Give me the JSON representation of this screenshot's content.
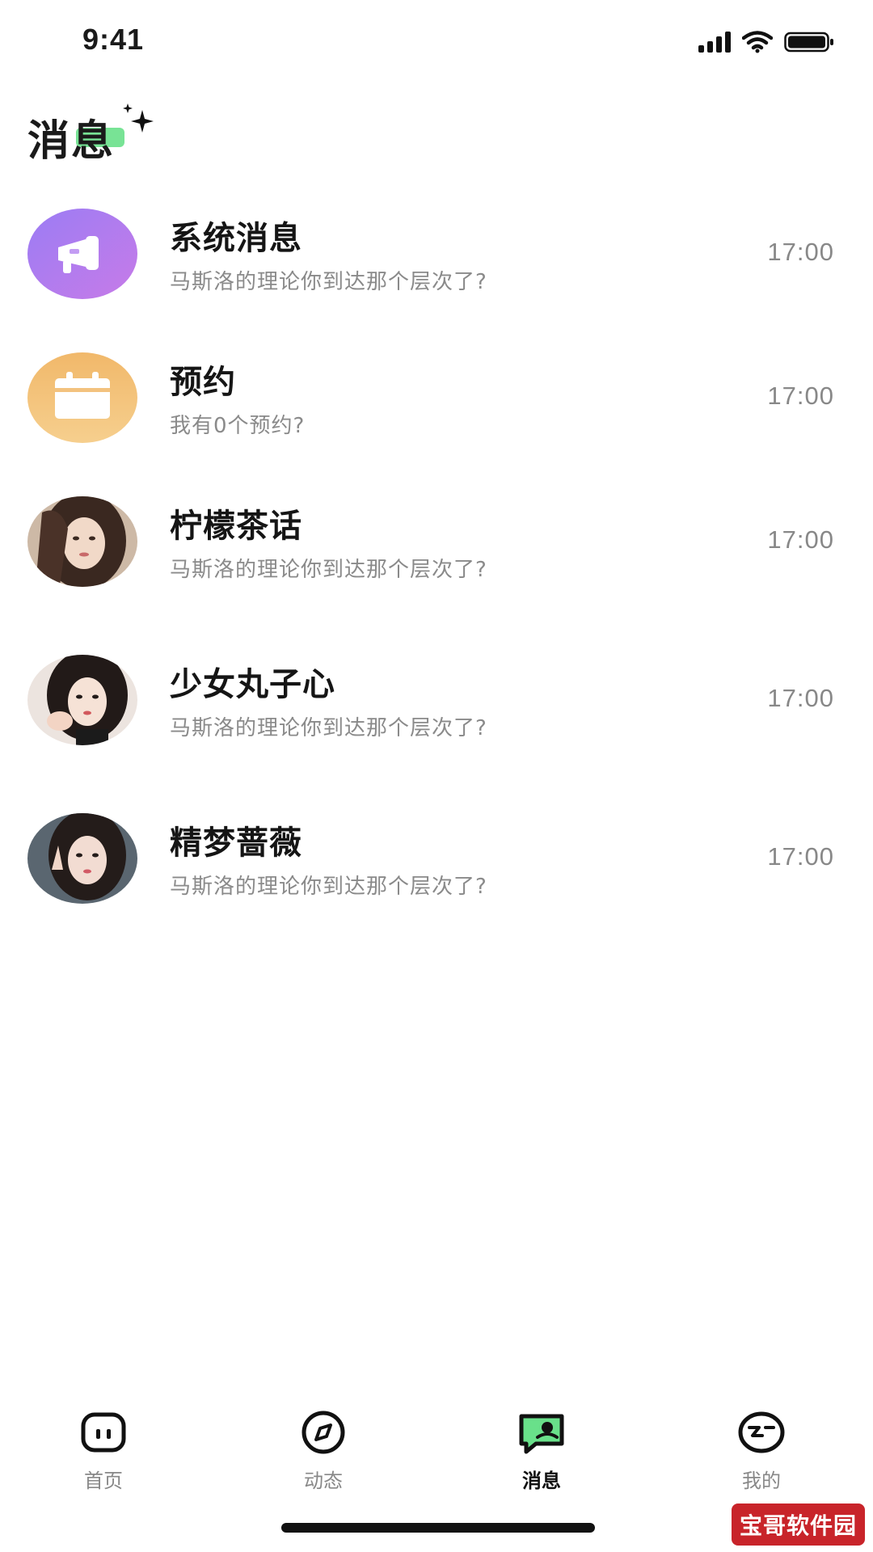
{
  "status_bar": {
    "time": "9:41"
  },
  "header": {
    "title": "消息"
  },
  "messages": [
    {
      "name": "系统消息",
      "preview": "马斯洛的理论你到达那个层次了?",
      "time": "17:00",
      "avatar": "megaphone-icon"
    },
    {
      "name": "预约",
      "preview": "我有0个预约?",
      "time": "17:00",
      "avatar": "calendar-icon"
    },
    {
      "name": "柠檬茶话",
      "preview": "马斯洛的理论你到达那个层次了?",
      "time": "17:00",
      "avatar": "user-photo"
    },
    {
      "name": "少女丸子心",
      "preview": "马斯洛的理论你到达那个层次了?",
      "time": "17:00",
      "avatar": "user-photo"
    },
    {
      "name": "精梦蔷薇",
      "preview": "马斯洛的理论你到达那个层次了?",
      "time": "17:00",
      "avatar": "user-photo"
    }
  ],
  "tabs": [
    {
      "label": "首页",
      "icon": "home-icon",
      "active": false
    },
    {
      "label": "动态",
      "icon": "compass-icon",
      "active": false
    },
    {
      "label": "消息",
      "icon": "message-icon",
      "active": true
    },
    {
      "label": "我的",
      "icon": "profile-icon",
      "active": false
    }
  ],
  "watermark": "宝哥软件园",
  "colors": {
    "accent": "#69e08a",
    "system_avatar": "#a77cf0",
    "booking_avatar": "#f2b468",
    "muted_text": "#8a8a8a"
  }
}
